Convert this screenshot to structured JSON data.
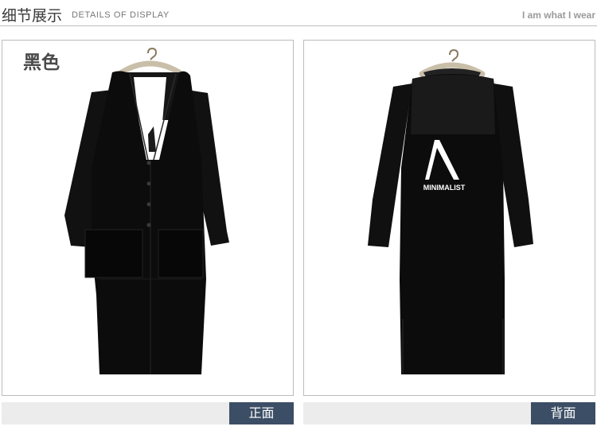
{
  "header": {
    "title_cn": "细节展示",
    "title_en": "DETAILS OF DISPLAY",
    "tagline": "I am what I wear"
  },
  "left_panel": {
    "color_label": "黑色",
    "caption": "正面"
  },
  "right_panel": {
    "print_text": "MINIMALIST",
    "caption": "背面"
  },
  "colors": {
    "garment": "#0c0c0c",
    "caption_bg": "#3c4e65",
    "bar_bg": "#ececec"
  },
  "icons": {
    "hanger": "hanger-icon"
  }
}
